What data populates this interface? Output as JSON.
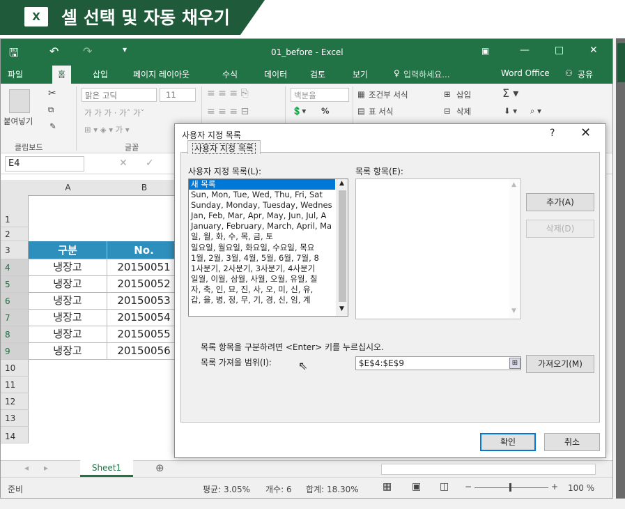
{
  "lesson": {
    "icon_label": "X",
    "title": "셀 선택 및 자동 채우기"
  },
  "titlebar": {
    "doc_title": "01_before - Excel"
  },
  "ribbon_tabs": [
    "파일",
    "홈",
    "삽입",
    "페이지 레이아웃",
    "수식",
    "데이터",
    "검토",
    "보기"
  ],
  "tell_me": "입력하세요...",
  "account": "Word Office",
  "share": "공유",
  "ribbon": {
    "paste": "붙여넣기",
    "font_name": "맑은 고딕",
    "font_size": "11",
    "number_format": "백분율",
    "percent": "%",
    "cond_format": "조건부 서식",
    "table_format": "표 서식",
    "insert": "삽입",
    "delete": "삭제",
    "groups": {
      "clipboard": "클립보드",
      "font": "글꼴"
    }
  },
  "formula_bar": {
    "namebox": "E4"
  },
  "grid": {
    "columns": [
      "A",
      "B"
    ],
    "rows": [
      "1",
      "2",
      "3",
      "4",
      "5",
      "6",
      "7",
      "8",
      "9",
      "10",
      "11",
      "12",
      "13",
      "14"
    ],
    "header": {
      "a": "구분",
      "b": "No."
    },
    "data": [
      {
        "a": "냉장고",
        "b": "20150051"
      },
      {
        "a": "냉장고",
        "b": "20150052"
      },
      {
        "a": "냉장고",
        "b": "20150053"
      },
      {
        "a": "냉장고",
        "b": "20150054"
      },
      {
        "a": "냉장고",
        "b": "20150055"
      },
      {
        "a": "냉장고",
        "b": "20150056"
      }
    ]
  },
  "sheet_tab": "Sheet1",
  "status": {
    "ready": "준비",
    "average": "평균: 3.05%",
    "count": "개수: 6",
    "sum": "합계: 18.30%",
    "zoom": "100 %"
  },
  "dialog": {
    "title": "사용자 지정 목록",
    "help": "?",
    "close": "✕",
    "tab": "사용자 지정 목록",
    "lists_label": "사용자 지정 목록(L):",
    "entries_label": "목록 항목(E):",
    "lists": [
      "새 목록",
      "Sun, Mon, Tue, Wed, Thu, Fri, Sat",
      "Sunday, Monday, Tuesday, Wednes",
      "Jan, Feb, Mar, Apr, May, Jun, Jul, A",
      "January, February, March, April, Ma",
      "일, 월, 화, 수, 목, 금, 토",
      "일요일, 월요일, 화요일, 수요일, 목요",
      "1월, 2월, 3월, 4월, 5월, 6월, 7월, 8",
      "1사분기, 2사분기, 3사분기, 4사분기",
      "일월, 이월, 삼월, 사월, 오월, 유월, 칠",
      "자, 축, 인, 묘, 진, 사, 오, 미, 신, 유,",
      "갑, 을, 병, 정, 무, 기, 경, 신, 임, 계"
    ],
    "add": "추가(A)",
    "delete": "삭제(D)",
    "hint": "목록 항목을 구분하려면 <Enter> 키를 누르십시오.",
    "import_label": "목록 가져올 범위(I):",
    "import_range": "$E$4:$E$9",
    "import_button": "가져오기(M)",
    "ok": "확인",
    "cancel": "취소"
  }
}
